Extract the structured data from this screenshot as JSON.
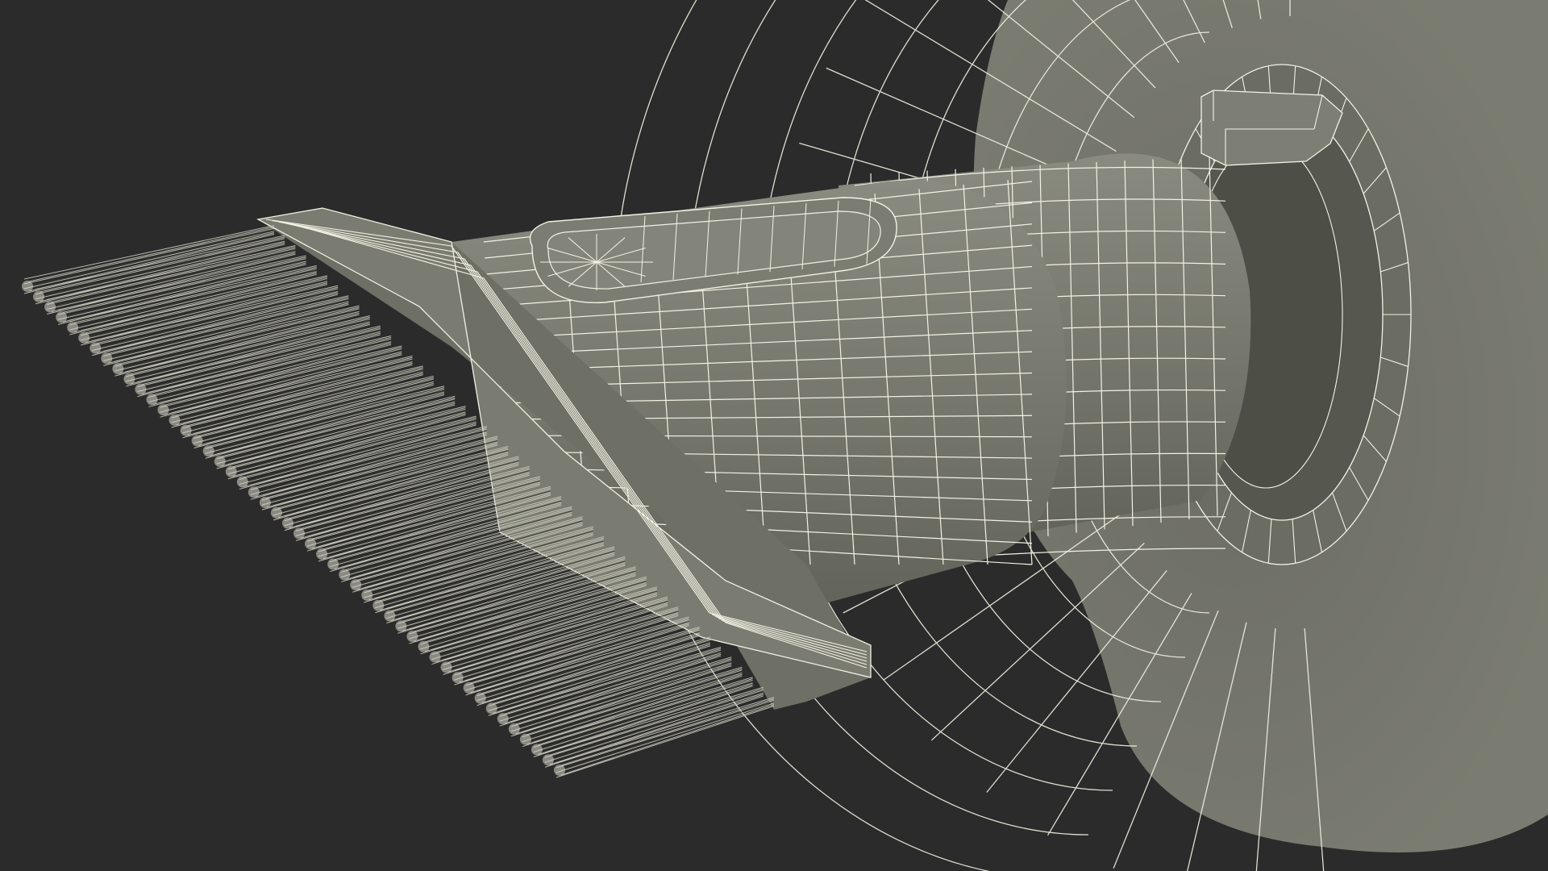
{
  "scene": {
    "subject": "vacuum-brush-attachment-wireframe",
    "render_mode": "wireframe-on-shaded",
    "colors": {
      "background": "#2b2b2b",
      "surface": "#7a7b70",
      "surface_dark": "#5e5f56",
      "surface_light": "#8c8d82",
      "wire": "#f2f2e4",
      "bristle": "#c8c8bc",
      "bristle_shadow": "#3a3d33"
    }
  }
}
